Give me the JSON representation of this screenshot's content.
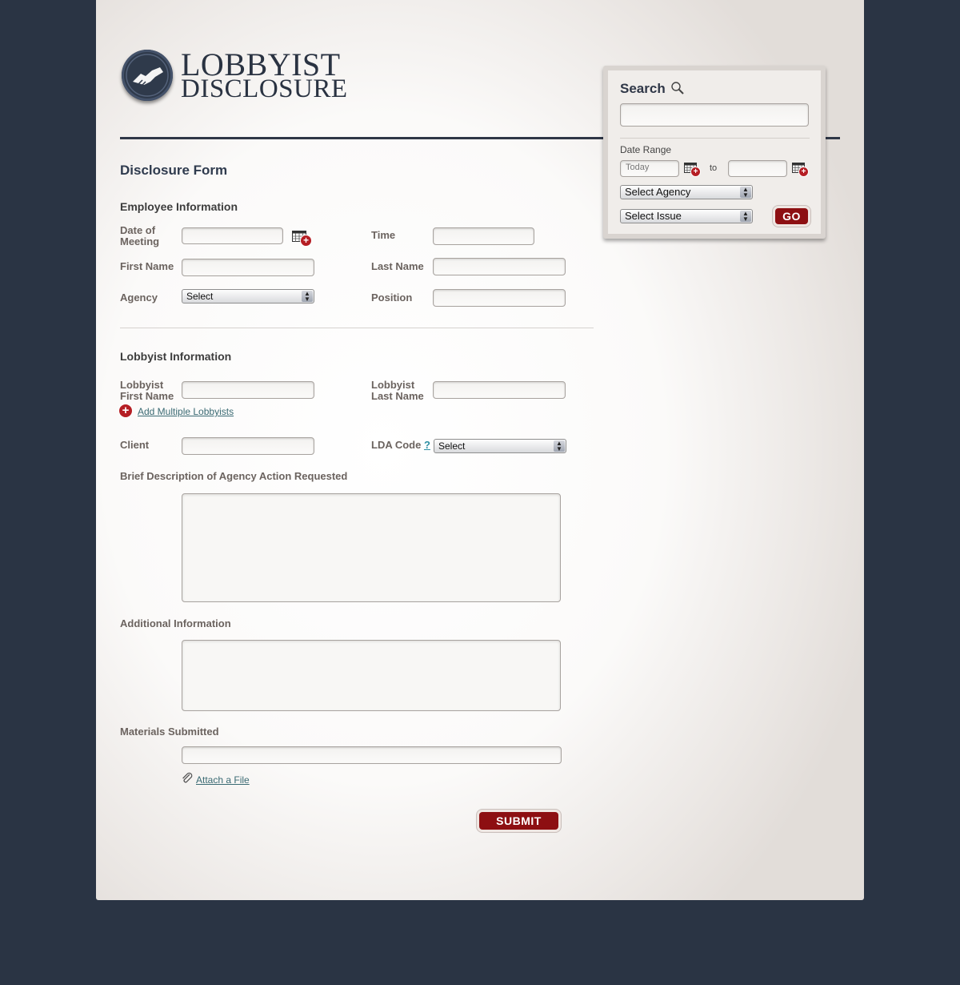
{
  "logo": {
    "line1": "LOBBYIST",
    "line2": "DISCLOSURE"
  },
  "form": {
    "title": "Disclosure Form",
    "employee_section": {
      "heading": "Employee Information",
      "date_label_1": "Date of",
      "date_label_2": "Meeting",
      "time_label": "Time",
      "first_name_label": "First Name",
      "last_name_label": "Last Name",
      "agency_label": "Agency",
      "agency_select_value": "Select",
      "position_label": "Position"
    },
    "lobbyist_section": {
      "heading": "Lobbyist Information",
      "first_name_label_1": "Lobbyist",
      "first_name_label_2": "First Name",
      "last_name_label_1": "Lobbyist",
      "last_name_label_2": "Last Name",
      "add_multiple_link": "Add Multiple Lobbyists",
      "client_label": "Client",
      "lda_label": "LDA Code",
      "lda_help": "?",
      "lda_select_value": "Select"
    },
    "description_label": "Brief Description of Agency Action Requested",
    "additional_label": "Additional Information",
    "materials_label": "Materials Submitted",
    "attach_link": "Attach a File",
    "submit_label": "SUBMIT"
  },
  "search": {
    "title": "Search",
    "date_range_label": "Date Range",
    "from_value": "Today",
    "to_label": "to",
    "agency_select": "Select Agency",
    "issue_select": "Select Issue",
    "go_label": "GO"
  },
  "icons": [
    "handshake-icon",
    "magnifier-icon",
    "calendar-add-icon",
    "plus-circle-icon",
    "paperclip-icon",
    "select-arrows-icon"
  ],
  "colors": {
    "background": "#2a3444",
    "accent_red": "#8d0f12",
    "link": "#3a6a73",
    "navy": "#2f3a4b"
  }
}
